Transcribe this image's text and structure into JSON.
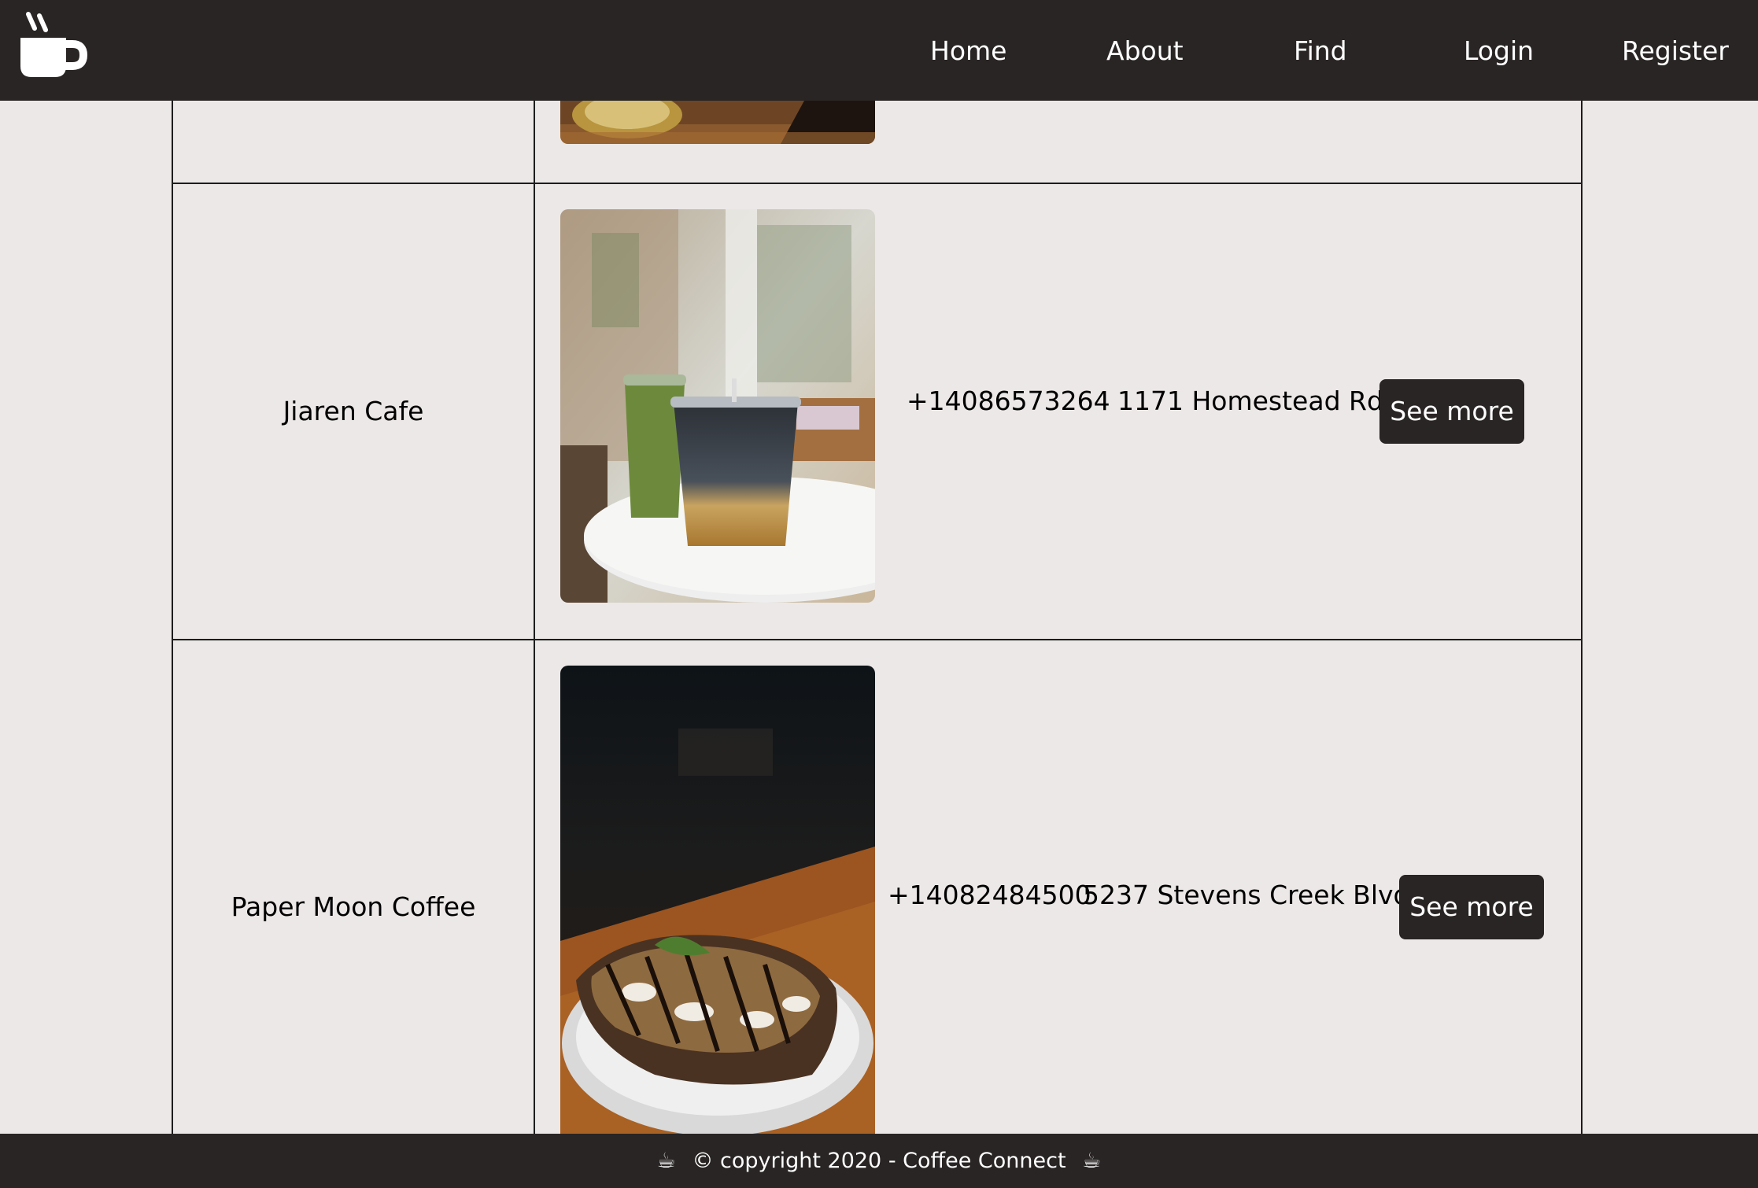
{
  "nav": {
    "logo_icon": "coffee-cup-icon",
    "links": [
      "Home",
      "About",
      "Find",
      "Login",
      "Register"
    ]
  },
  "cafes": [
    {
      "name": "",
      "photo": "cropped-drink-on-wooden-table"
    },
    {
      "name": "Jiaren Cafe",
      "photo": "matcha-and-coffee-iced-drinks",
      "phone": "+14086573264",
      "address": "1171 Homestead Rd",
      "button": "See more"
    },
    {
      "name": "Paper Moon Coffee",
      "photo": "granola-toast-on-plate",
      "phone": "+14082484500",
      "address": "5237 Stevens Creek Blvd",
      "button": "See more"
    }
  ],
  "footer": {
    "icon": "coffee-cup-emoji",
    "text": "© copyright 2020 - Coffee Connect"
  },
  "colors": {
    "navbar": "#292524",
    "background": "#ece8e7",
    "button": "#292524"
  }
}
